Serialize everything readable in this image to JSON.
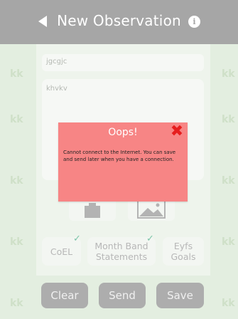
{
  "header": {
    "title": "New Observation",
    "back_icon": "back-arrow-icon",
    "info_icon": "info-icon",
    "info_glyph": "i"
  },
  "form": {
    "title_value": "jgcgjc",
    "notes_value": "khvkv"
  },
  "background": {
    "pattern_text": "kk"
  },
  "media": {
    "camera_icon": "camera-icon",
    "gallery_icon": "image-icon"
  },
  "categories": [
    {
      "label": "CoEL",
      "checked": true
    },
    {
      "label": "Month Band Statements",
      "checked": true
    },
    {
      "label": "Eyfs Goals",
      "checked": false
    }
  ],
  "actions": {
    "clear": "Clear",
    "send": "Send",
    "save": "Save"
  },
  "dialog": {
    "title": "Oops!",
    "close_glyph": "✖",
    "message": "Cannot connect to the Internet. You can save and send later when you have a connection."
  },
  "colors": {
    "header": "#a6a6a6",
    "dialog": "#f78585",
    "close": "#e61e1e",
    "check": "#7cc5a8",
    "footer_button": "#adadad"
  }
}
